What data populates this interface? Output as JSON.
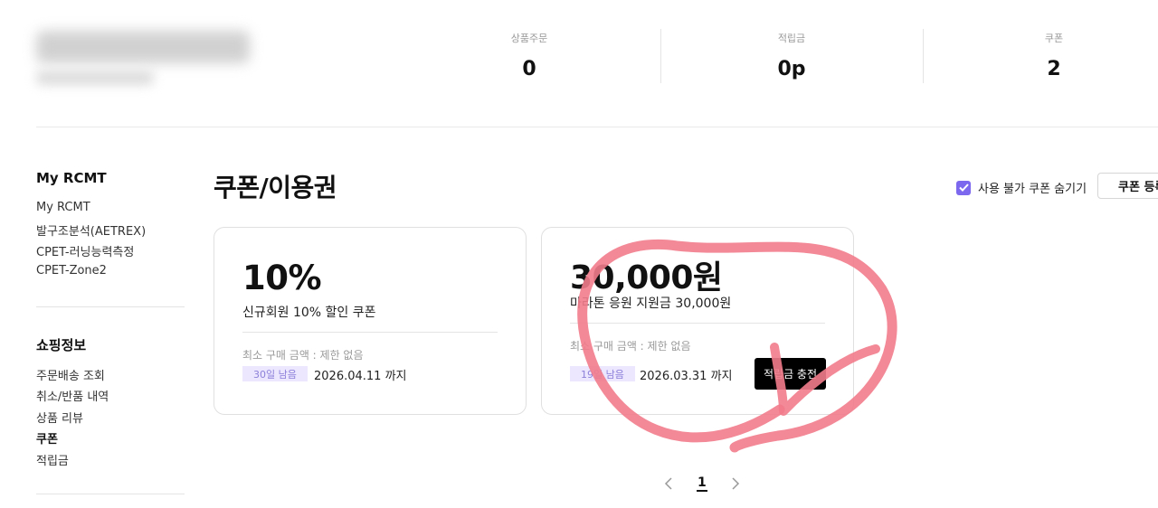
{
  "header": {
    "stats": [
      {
        "label": "상품주문",
        "value": "0"
      },
      {
        "label": "적립금",
        "value": "0p"
      },
      {
        "label": "쿠폰",
        "value": "2"
      }
    ]
  },
  "sidebar": {
    "sections": [
      {
        "title": "My RCMT",
        "items": [
          "My RCMT",
          "발구조분석(AETREX)",
          "CPET-러닝능력측정",
          "CPET-Zone2"
        ]
      },
      {
        "title": "쇼핑정보",
        "items": [
          "주문배송 조회",
          "취소/반품 내역",
          "상품 리뷰",
          "쿠폰",
          "적립금"
        ]
      }
    ],
    "active_item": "쿠폰"
  },
  "main": {
    "title": "쿠폰/이용권",
    "hide_unusable_label": "사용 불가 쿠폰 숨기기",
    "hide_unusable_checked": true,
    "register_button": "쿠폰 등록",
    "coupons": [
      {
        "amount": "10%",
        "description": "신규회원 10% 할인 쿠폰",
        "min_purchase": "최소 구매 금액 : 제한 없음",
        "days_left": "30일 남음",
        "expires": "2026.04.11 까지"
      },
      {
        "amount": "30,000원",
        "description": "마라톤 응원 지원금 30,000원",
        "min_purchase": "최소 구매 금액 : 제한 없음",
        "days_left": "19일 남음",
        "expires": "2026.03.31 까지",
        "action": "적립금 충전"
      }
    ]
  },
  "pagination": {
    "current": "1"
  },
  "colors": {
    "accent": "#7b68ee",
    "badge_bg": "#ece7ff",
    "annotation": "#f27b8b"
  }
}
